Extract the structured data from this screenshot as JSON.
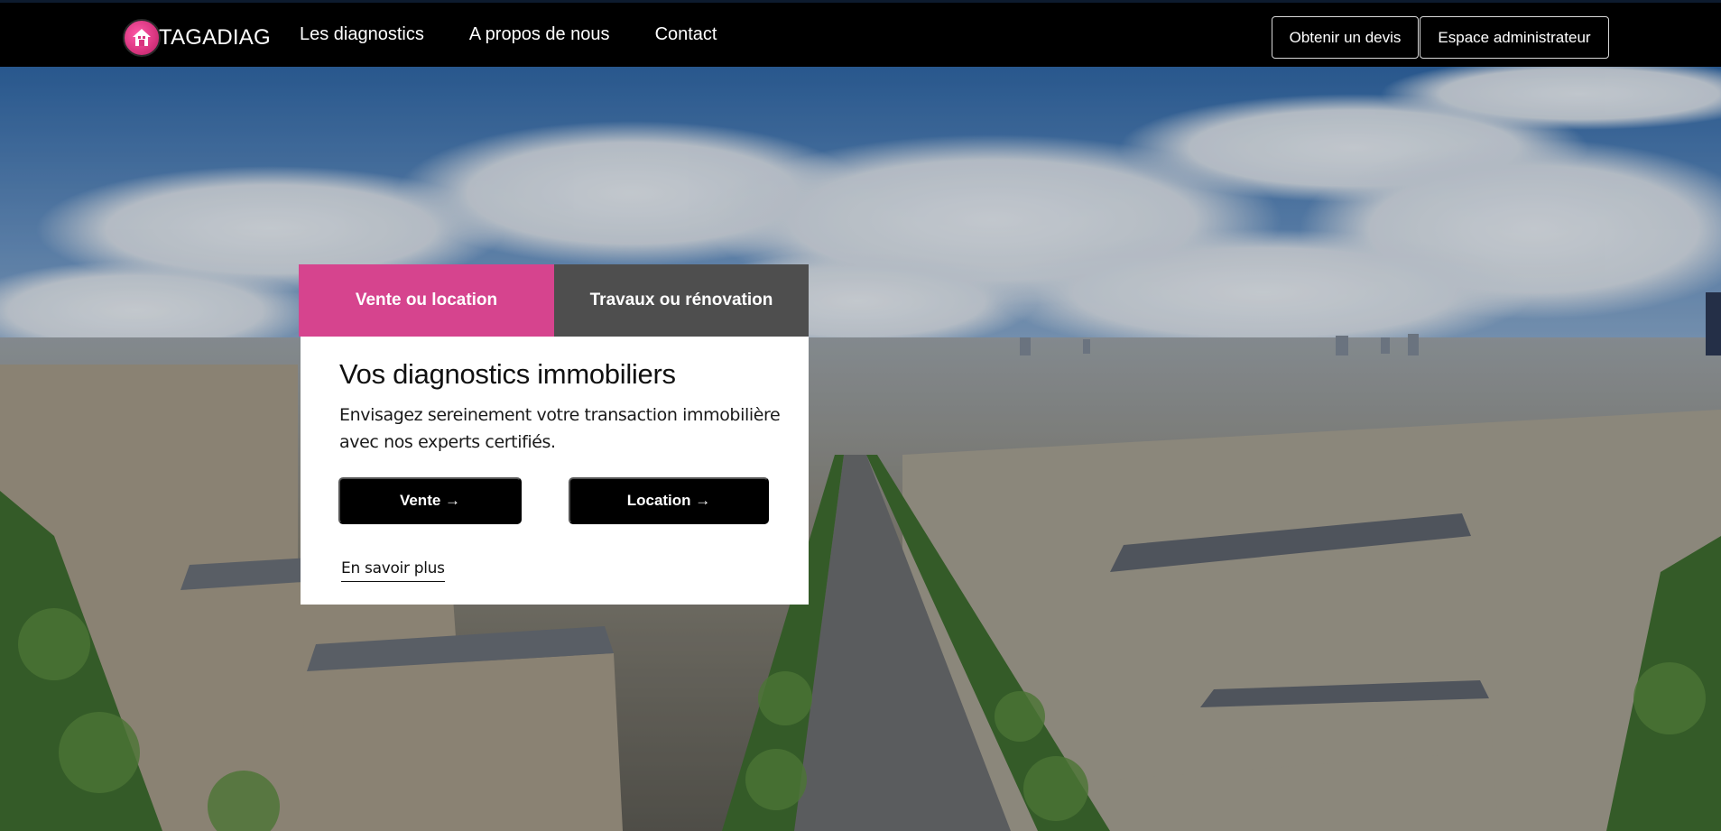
{
  "brand": {
    "name": "TAGADIAG",
    "logo_icon": "house-icon",
    "accent": "#d6448e"
  },
  "nav": {
    "links": [
      {
        "label": "Les diagnostics"
      },
      {
        "label": "A propos de nous"
      },
      {
        "label": "Contact"
      }
    ],
    "quote_button": "Obtenir un devis",
    "admin_button": "Espace administrateur"
  },
  "hero": {
    "tabs": [
      {
        "label": "Vente ou location",
        "active": true,
        "color": "#d6448e"
      },
      {
        "label": "Travaux ou rénovation",
        "active": false,
        "color": "#4e4e4e"
      }
    ],
    "title": "Vos diagnostics immobiliers",
    "description": "Envisagez sereinement votre transaction immobilière avec nos experts certifiés.",
    "buttons": {
      "sale": "Vente →",
      "rental": "Location →"
    },
    "learn_more": "En savoir plus"
  }
}
